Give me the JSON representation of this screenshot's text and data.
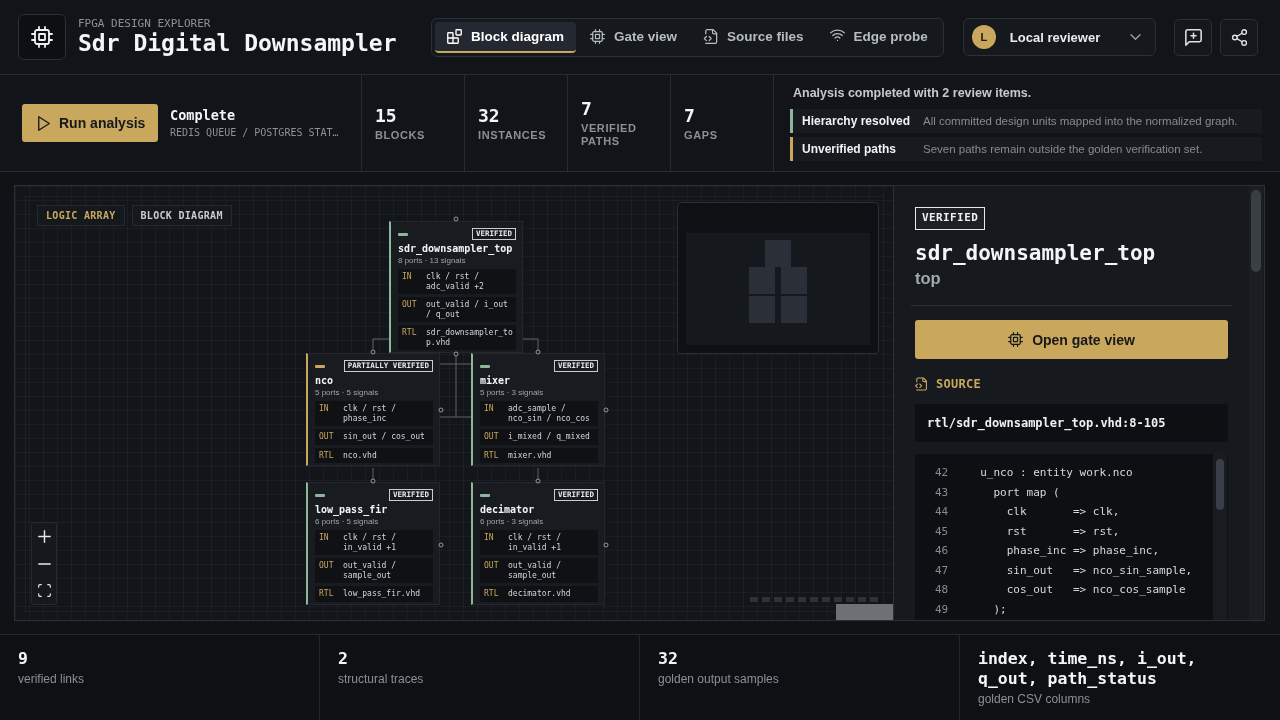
{
  "header": {
    "eyebrow": "FPGA DESIGN EXPLORER",
    "title": "Sdr Digital Downsampler",
    "tabs": [
      {
        "label": "Block diagram",
        "selected": true
      },
      {
        "label": "Gate view",
        "selected": false
      },
      {
        "label": "Source files",
        "selected": false
      },
      {
        "label": "Edge probe",
        "selected": false
      }
    ],
    "user": {
      "initial": "L",
      "name": "Local reviewer"
    }
  },
  "analysis_bar": {
    "run_button": "Run analysis",
    "status": "Complete",
    "status_detail": "REDIS QUEUE / POSTGRES STAT…",
    "stats": [
      {
        "value": "15",
        "label": "BLOCKS"
      },
      {
        "value": "32",
        "label": "INSTANCES"
      },
      {
        "value": "7",
        "label": "VERIFIED PATHS"
      },
      {
        "value": "7",
        "label": "GAPS"
      }
    ],
    "review": {
      "summary": "Analysis completed with 2 review items.",
      "items": [
        {
          "title": "Hierarchy resolved",
          "description": "All committed design units mapped into the normalized graph.",
          "color": "#8fb59b"
        },
        {
          "title": "Unverified paths",
          "description": "Seven paths remain outside the golden verification set.",
          "color": "#c9a75d"
        }
      ]
    }
  },
  "canvas": {
    "labels": [
      {
        "text": "LOGIC ARRAY",
        "color": "#c9a75d"
      },
      {
        "text": "BLOCK DIAGRAM",
        "color": "#c8ccd2"
      }
    ],
    "nodes": [
      {
        "name": "sdr_downsampler_top",
        "status": "VERIFIED",
        "color": "#8fb59b",
        "meta": "8 ports · 13 signals",
        "rows": [
          {
            "tag": "IN",
            "text": "clk / rst / adc_valid +2"
          },
          {
            "tag": "OUT",
            "text": "out_valid / i_out / q_out"
          },
          {
            "tag": "RTL",
            "text": "sdr_downsampler_top.vhd"
          }
        ]
      },
      {
        "name": "nco",
        "status": "PARTIALLY VERIFIED",
        "color": "#c9a75d",
        "meta": "5 ports · 5 signals",
        "rows": [
          {
            "tag": "IN",
            "text": "clk / rst / phase_inc"
          },
          {
            "tag": "OUT",
            "text": "sin_out / cos_out"
          },
          {
            "tag": "RTL",
            "text": "nco.vhd"
          }
        ]
      },
      {
        "name": "mixer",
        "status": "VERIFIED",
        "color": "#8fb59b",
        "meta": "5 ports · 3 signals",
        "rows": [
          {
            "tag": "IN",
            "text": "adc_sample / nco_sin / nco_cos"
          },
          {
            "tag": "OUT",
            "text": "i_mixed / q_mixed"
          },
          {
            "tag": "RTL",
            "text": "mixer.vhd"
          }
        ]
      },
      {
        "name": "low_pass_fir",
        "status": "VERIFIED",
        "color": "#8fb59b",
        "meta": "6 ports · 5 signals",
        "rows": [
          {
            "tag": "IN",
            "text": "clk / rst / in_valid +1"
          },
          {
            "tag": "OUT",
            "text": "out_valid / sample_out"
          },
          {
            "tag": "RTL",
            "text": "low_pass_fir.vhd"
          }
        ]
      },
      {
        "name": "decimator",
        "status": "VERIFIED",
        "color": "#8fb59b",
        "meta": "6 ports · 3 signals",
        "rows": [
          {
            "tag": "IN",
            "text": "clk / rst / in_valid +1"
          },
          {
            "tag": "OUT",
            "text": "out_valid / sample_out"
          },
          {
            "tag": "RTL",
            "text": "decimator.vhd"
          }
        ]
      }
    ]
  },
  "details": {
    "badge": "VERIFIED",
    "name": "sdr_downsampler_top",
    "role": "top",
    "action": "Open gate view",
    "source_label": "SOURCE",
    "source_path": "rtl/sdr_downsampler_top.vhd:8-105",
    "code_lines": [
      {
        "number": "42",
        "text": "  u_nco : entity work.nco"
      },
      {
        "number": "43",
        "text": "    port map ("
      },
      {
        "number": "44",
        "text": "      clk       => clk,"
      },
      {
        "number": "45",
        "text": "      rst       => rst,"
      },
      {
        "number": "46",
        "text": "      phase_inc => phase_inc,"
      },
      {
        "number": "47",
        "text": "      sin_out   => nco_sin_sample,"
      },
      {
        "number": "48",
        "text": "      cos_out   => nco_cos_sample"
      },
      {
        "number": "49",
        "text": "    );"
      }
    ]
  },
  "summary_metrics": [
    {
      "value": "9",
      "label": "verified links"
    },
    {
      "value": "2",
      "label": "structural traces"
    },
    {
      "value": "32",
      "label": "golden output samples"
    },
    {
      "value": "index, time_ns, i_out, q_out, path_status",
      "label": "golden CSV columns"
    }
  ]
}
